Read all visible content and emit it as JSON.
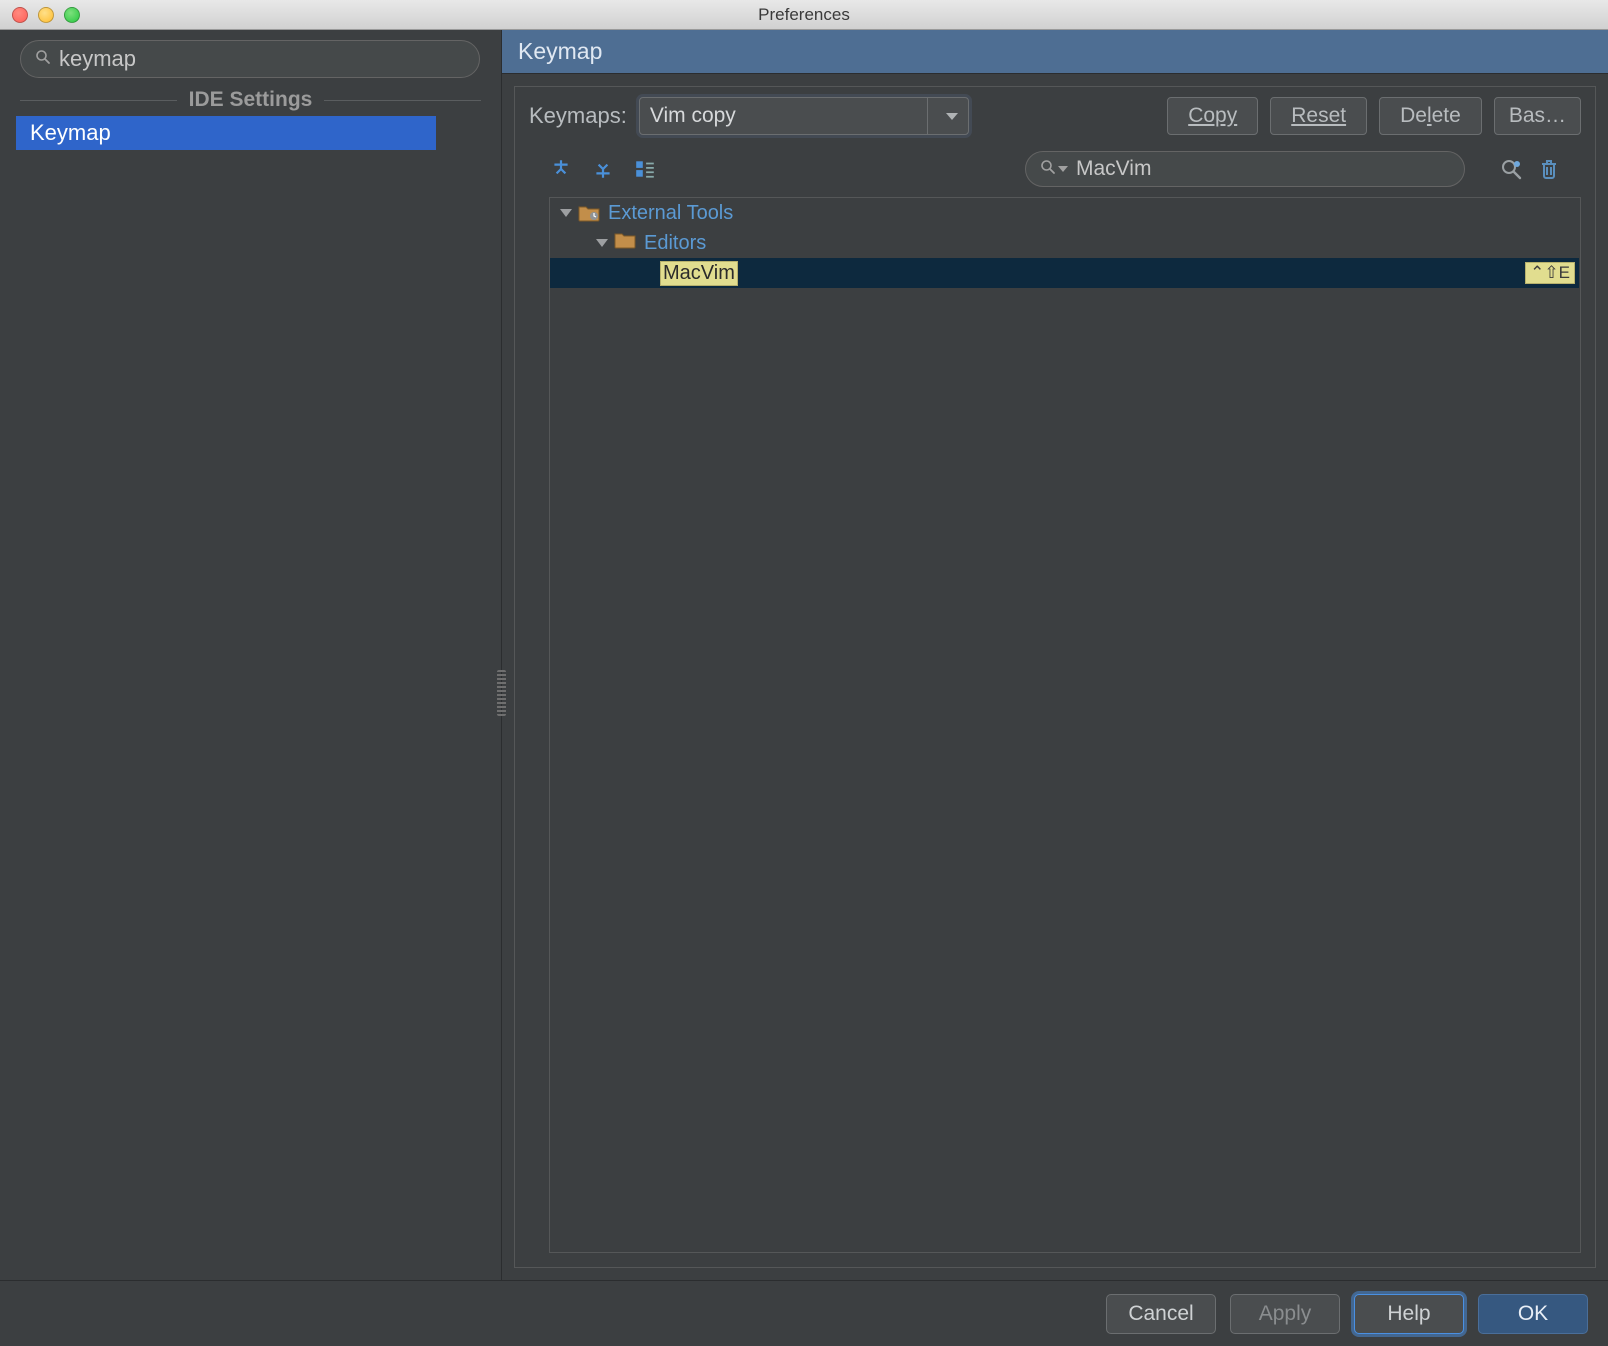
{
  "window": {
    "title": "Preferences"
  },
  "sidebar": {
    "search": "keymap",
    "section": "IDE Settings",
    "items": [
      "Keymap"
    ]
  },
  "panel": {
    "title": "Keymap",
    "keymaps_label": "Keymaps:",
    "keymaps_value": "Vim copy",
    "copy_btn": "Copy",
    "reset_btn": "Reset",
    "delete_btn": "Delete",
    "based_btn": "Bas…",
    "tree_search": "MacVim",
    "tree": {
      "node0": "External Tools",
      "node1": "Editors",
      "leaf": "MacVim",
      "shortcut": "⌃⇧E"
    }
  },
  "footer": {
    "cancel": "Cancel",
    "apply": "Apply",
    "help": "Help",
    "ok": "OK"
  }
}
